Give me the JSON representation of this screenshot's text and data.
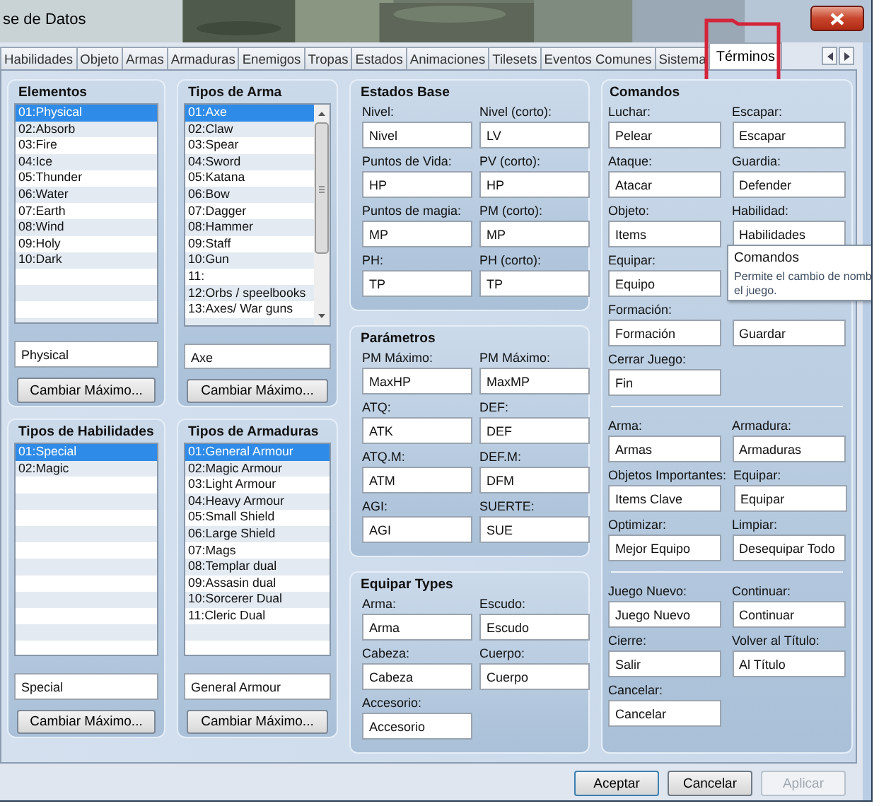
{
  "window": {
    "title": "se de Datos"
  },
  "tabs": [
    {
      "label": "Habilidades",
      "selected": false
    },
    {
      "label": "Objeto",
      "selected": false
    },
    {
      "label": "Armas",
      "selected": false
    },
    {
      "label": "Armaduras",
      "selected": false
    },
    {
      "label": "Enemigos",
      "selected": false
    },
    {
      "label": "Tropas",
      "selected": false
    },
    {
      "label": "Estados",
      "selected": false
    },
    {
      "label": "Animaciones",
      "selected": false
    },
    {
      "label": "Tilesets",
      "selected": false
    },
    {
      "label": "Eventos Comunes",
      "selected": false
    },
    {
      "label": "Sistema",
      "selected": false
    },
    {
      "label": "Términos",
      "selected": true
    }
  ],
  "lists": [
    {
      "title": "Elementos",
      "value": "Physical",
      "button": "Cambiar Máximo...",
      "items": [
        {
          "label": "01:Physical",
          "selected": true
        },
        {
          "label": "02:Absorb",
          "selected": false
        },
        {
          "label": "03:Fire",
          "selected": false
        },
        {
          "label": "04:Ice",
          "selected": false
        },
        {
          "label": "05:Thunder",
          "selected": false
        },
        {
          "label": "06:Water",
          "selected": false
        },
        {
          "label": "07:Earth",
          "selected": false
        },
        {
          "label": "08:Wind",
          "selected": false
        },
        {
          "label": "09:Holy",
          "selected": false
        },
        {
          "label": "10:Dark",
          "selected": false
        }
      ]
    },
    {
      "title": "Tipos de Arma",
      "value": "Axe",
      "button": "Cambiar Máximo...",
      "items": [
        {
          "label": "01:Axe",
          "selected": true
        },
        {
          "label": "02:Claw",
          "selected": false
        },
        {
          "label": "03:Spear",
          "selected": false
        },
        {
          "label": "04:Sword",
          "selected": false
        },
        {
          "label": "05:Katana",
          "selected": false
        },
        {
          "label": "06:Bow",
          "selected": false
        },
        {
          "label": "07:Dagger",
          "selected": false
        },
        {
          "label": "08:Hammer",
          "selected": false
        },
        {
          "label": "09:Staff",
          "selected": false
        },
        {
          "label": "10:Gun",
          "selected": false
        },
        {
          "label": "11:",
          "selected": false
        },
        {
          "label": "12:Orbs / speelbooks",
          "selected": false
        },
        {
          "label": "13:Axes/ War guns",
          "selected": false
        }
      ]
    },
    {
      "title": "Tipos de Habilidades",
      "value": "Special",
      "button": "Cambiar Máximo...",
      "items": [
        {
          "label": "01:Special",
          "selected": true
        },
        {
          "label": "02:Magic",
          "selected": false
        }
      ]
    },
    {
      "title": "Tipos de Armaduras",
      "value": "General Armour",
      "button": "Cambiar Máximo...",
      "items": [
        {
          "label": "01:General Armour",
          "selected": true
        },
        {
          "label": "02:Magic Armour",
          "selected": false
        },
        {
          "label": "03:Light Armour",
          "selected": false
        },
        {
          "label": "04:Heavy Armour",
          "selected": false
        },
        {
          "label": "05:Small Shield",
          "selected": false
        },
        {
          "label": "06:Large Shield",
          "selected": false
        },
        {
          "label": "07:Mags",
          "selected": false
        },
        {
          "label": "08:Templar dual",
          "selected": false
        },
        {
          "label": "09:Assasin dual",
          "selected": false
        },
        {
          "label": "10:Sorcerer Dual",
          "selected": false
        },
        {
          "label": "11:Cleric Dual",
          "selected": false
        }
      ]
    }
  ],
  "groups": [
    {
      "title": "Estados Base",
      "rows": [
        [
          {
            "label": "Nivel:",
            "value": "Nivel"
          },
          {
            "label": "Nivel (corto):",
            "value": "LV"
          }
        ],
        [
          {
            "label": "Puntos de Vida:",
            "value": "HP"
          },
          {
            "label": "PV (corto):",
            "value": "HP"
          }
        ],
        [
          {
            "label": "Puntos de magia:",
            "value": "MP"
          },
          {
            "label": "PM (corto):",
            "value": "MP"
          }
        ],
        [
          {
            "label": "PH:",
            "value": "TP"
          },
          {
            "label": "PH (corto):",
            "value": "TP"
          }
        ]
      ]
    },
    {
      "title": "Parámetros",
      "rows": [
        [
          {
            "label": "PM Máximo:",
            "value": "MaxHP"
          },
          {
            "label": "PM Máximo:",
            "value": "MaxMP"
          }
        ],
        [
          {
            "label": "ATQ:",
            "value": "ATK"
          },
          {
            "label": "DEF:",
            "value": "DEF"
          }
        ],
        [
          {
            "label": "ATQ.M:",
            "value": "ATM"
          },
          {
            "label": "DEF.M:",
            "value": "DFM"
          }
        ],
        [
          {
            "label": "AGI:",
            "value": "AGI"
          },
          {
            "label": "SUERTE:",
            "value": "SUE"
          }
        ]
      ]
    },
    {
      "title": "Equipar Types",
      "rows": [
        [
          {
            "label": "Arma:",
            "value": "Arma"
          },
          {
            "label": "Escudo:",
            "value": "Escudo"
          }
        ],
        [
          {
            "label": "Cabeza:",
            "value": "Cabeza"
          },
          {
            "label": "Cuerpo:",
            "value": "Cuerpo"
          }
        ],
        [
          {
            "label": "Accesorio:",
            "value": "Accesorio"
          }
        ]
      ]
    }
  ],
  "commands": {
    "title": "Comandos",
    "sections": [
      [
        [
          {
            "label": "Luchar:",
            "value": "Pelear"
          },
          {
            "label": "Escapar:",
            "value": "Escapar"
          }
        ],
        [
          {
            "label": "Ataque:",
            "value": "Atacar"
          },
          {
            "label": "Guardia:",
            "value": "Defender"
          }
        ],
        [
          {
            "label": "Objeto:",
            "value": "Items"
          },
          {
            "label": "Habilidad:",
            "value": "Habilidades"
          }
        ],
        [
          {
            "label": "Equipar:",
            "value": "Equipo"
          }
        ],
        [
          {
            "label": "Formación:",
            "value": "Formación"
          },
          {
            "value": "Guardar"
          }
        ],
        [
          {
            "label": "Cerrar Juego:",
            "value": "Fin"
          }
        ]
      ],
      [
        [
          {
            "label": "Arma:",
            "value": "Armas"
          },
          {
            "label": "Armadura:",
            "value": "Armaduras"
          }
        ],
        [
          {
            "label": "Objetos Importantes:",
            "value": "Items Clave"
          },
          {
            "label": "Equipar:",
            "value": "Equipar"
          }
        ],
        [
          {
            "label": "Optimizar:",
            "value": "Mejor Equipo"
          },
          {
            "label": "Limpiar:",
            "value": "Desequipar Todo"
          }
        ]
      ],
      [
        [
          {
            "label": "Juego Nuevo:",
            "value": "Juego Nuevo"
          },
          {
            "label": "Continuar:",
            "value": "Continuar"
          }
        ],
        [
          {
            "label": "Cierre:",
            "value": "Salir"
          },
          {
            "label": "Volver al Título:",
            "value": "Al Título"
          }
        ],
        [
          {
            "label": "Cancelar:",
            "value": "Cancelar"
          }
        ]
      ]
    ]
  },
  "tooltip": {
    "title": "Comandos",
    "lines": [
      "Permite el cambio de nomb",
      "el juego."
    ]
  },
  "buttons": [
    {
      "label": "Aceptar",
      "disabled": false
    },
    {
      "label": "Cancelar",
      "disabled": false
    },
    {
      "label": "Aplicar",
      "disabled": true
    }
  ]
}
